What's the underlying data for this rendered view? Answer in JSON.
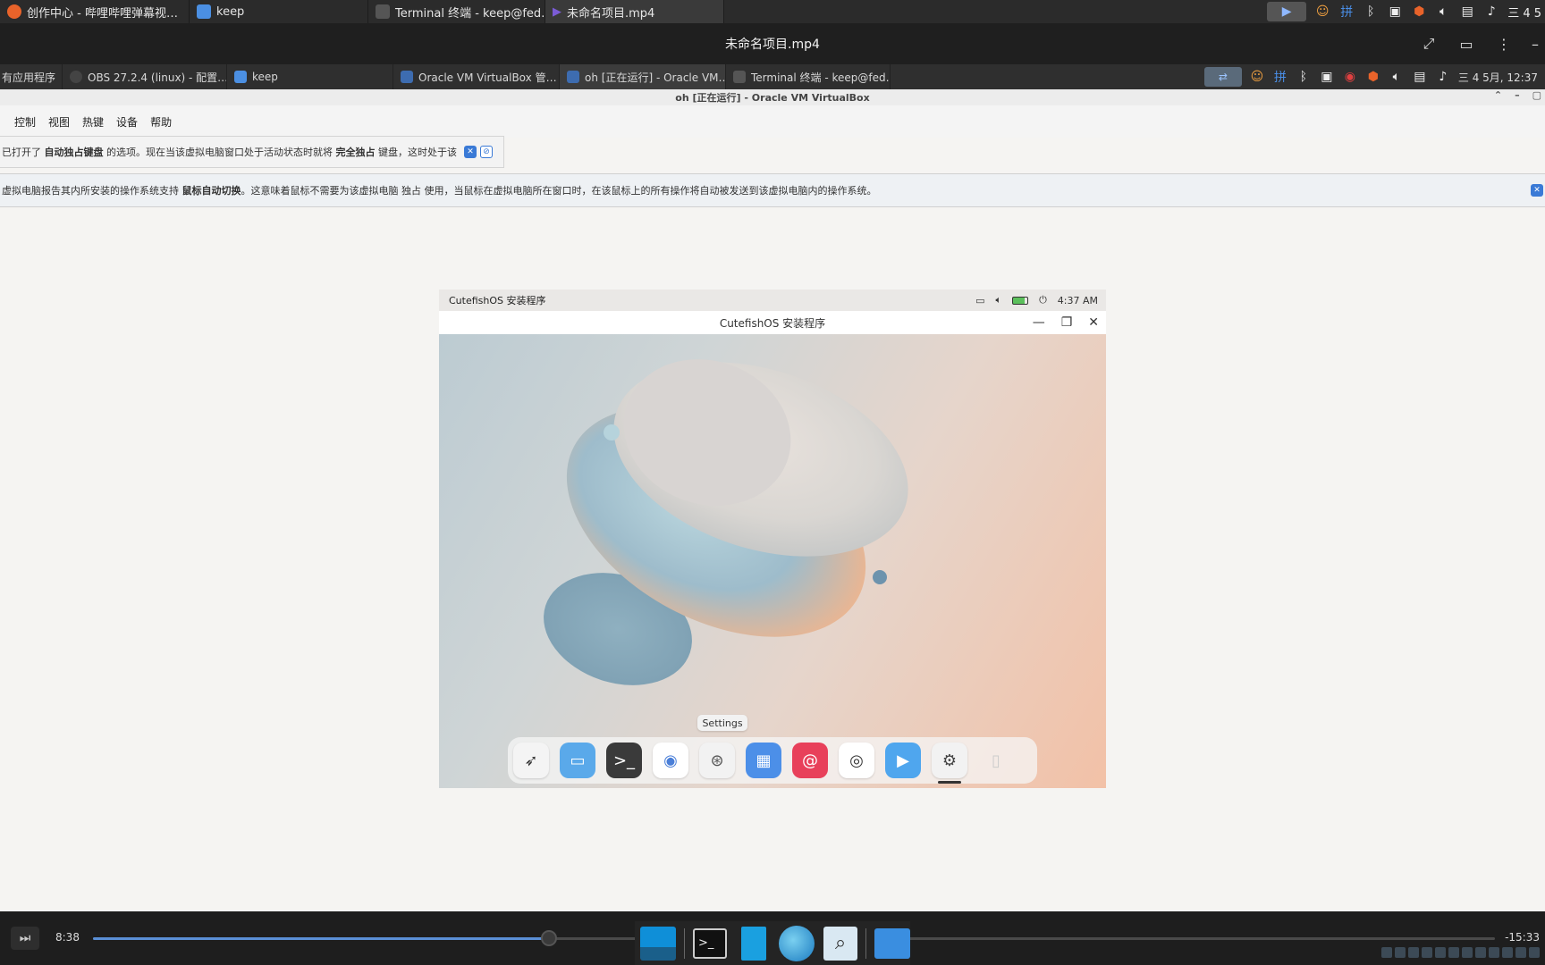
{
  "outer_taskbar": {
    "tabs": [
      {
        "label": "创作中心 - 哔哩哔哩弹幕视…",
        "icon": "firefox-icon",
        "color": "#e8632a"
      },
      {
        "label": "keep",
        "icon": "folder-icon",
        "color": "#4b8fe2"
      },
      {
        "label": "Terminal 终端 - keep@fed…",
        "icon": "terminal-icon",
        "color": "#555555"
      },
      {
        "label": "未命名项目.mp4",
        "icon": "play-icon",
        "color": "#7b5cd6"
      }
    ],
    "tray_clock": "三 4 5"
  },
  "player": {
    "title": "未命名项目.mp4",
    "current_time": "8:38",
    "remaining_time": "-15:33",
    "progress": 0.325
  },
  "inner_taskbar": {
    "apps_label": "有应用程序",
    "tabs": [
      {
        "label": "OBS 27.2.4 (linux) - 配置…",
        "icon": "obs-icon",
        "color": "#444444"
      },
      {
        "label": "keep",
        "icon": "folder-icon",
        "color": "#4b8fe2"
      },
      {
        "label": "Oracle VM VirtualBox 管…",
        "icon": "virtualbox-icon",
        "color": "#3d6cb0"
      },
      {
        "label": "oh [正在运行] - Oracle VM…",
        "icon": "virtualbox-icon",
        "color": "#3d6cb0"
      },
      {
        "label": "Terminal 终端 - keep@fed…",
        "icon": "terminal-icon",
        "color": "#555555"
      }
    ],
    "clock": "三 4 5月, 12:37"
  },
  "vbox": {
    "title": "oh [正在运行] - Oracle VM VirtualBox",
    "menu": [
      "控制",
      "视图",
      "热键",
      "设备",
      "帮助"
    ],
    "notice1_prefix": "已打开了 ",
    "notice1_bold1": "自动独占键盘",
    "notice1_mid": " 的选项。现在当该虚拟电脑窗口处于活动状态时就将 ",
    "notice1_bold2": "完全独占",
    "notice1_suffix": " 键盘，这时处于该",
    "notice2_prefix": "虚拟电脑报告其内所安装的操作系统支持 ",
    "notice2_bold": "鼠标自动切换",
    "notice2_suffix": "。这意味着鼠标不需要为该虚拟电脑 独占 使用，当鼠标在虚拟电脑所在窗口时，在该鼠标上的所有操作将自动被发送到该虚拟电脑内的操作系统。"
  },
  "vm": {
    "topbar_title": "CutefishOS 安装程序",
    "time": "4:37 AM",
    "window_title": "CutefishOS 安装程序",
    "tooltip": "Settings",
    "dock": [
      {
        "name": "launcher-icon",
        "bg": "#f4f4f4",
        "glyph": "➶",
        "fg": "#333333"
      },
      {
        "name": "files-icon",
        "bg": "#5aa9ea",
        "glyph": "▭",
        "fg": "#ffffff"
      },
      {
        "name": "terminal-icon",
        "bg": "#3a3a3a",
        "glyph": ">_",
        "fg": "#ffffff"
      },
      {
        "name": "chromium-icon",
        "bg": "#ffffff",
        "glyph": "◉",
        "fg": "#4a7fd8"
      },
      {
        "name": "installer-icon",
        "bg": "#f2f2f2",
        "glyph": "⊛",
        "fg": "#555555"
      },
      {
        "name": "calculator-icon",
        "bg": "#4c8fe8",
        "glyph": "▦",
        "fg": "#ffffff"
      },
      {
        "name": "debian-icon",
        "bg": "#e8405a",
        "glyph": "@",
        "fg": "#ffffff"
      },
      {
        "name": "screenshot-icon",
        "bg": "#ffffff",
        "glyph": "◎",
        "fg": "#333333"
      },
      {
        "name": "video-player-icon",
        "bg": "#4fa6ee",
        "glyph": "▶",
        "fg": "#ffffff"
      },
      {
        "name": "settings-icon",
        "bg": "#f2f2f2",
        "glyph": "⚙",
        "fg": "#444444"
      },
      {
        "name": "trash-icon",
        "bg": "transparent",
        "glyph": "▯",
        "fg": "#cccccc"
      }
    ]
  }
}
